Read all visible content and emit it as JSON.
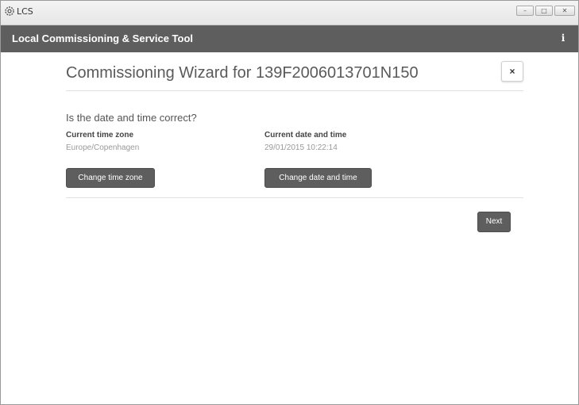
{
  "os_window": {
    "title": "LCS",
    "app_icon": "gear-icon",
    "controls": {
      "minimize": "–",
      "maximize": "□",
      "close": "✕"
    }
  },
  "app_header": {
    "title": "Local Commissioning & Service Tool",
    "info_label": "i"
  },
  "wizard": {
    "title": "Commissioning Wizard for 139F2006013701N150",
    "close_label": "×",
    "question": "Is the date and time correct?",
    "time_zone": {
      "label": "Current time zone",
      "value": "Europe/Copenhagen",
      "button": "Change time zone"
    },
    "date_time": {
      "label": "Current date and time",
      "value": "29/01/2015 10:22:14",
      "button": "Change date and time"
    },
    "next_label": "Next"
  },
  "colors": {
    "header_bg": "#5e5e5e",
    "button_bg": "#5e5e5e",
    "title_text": "#5a5a5a",
    "muted_text": "#999999"
  }
}
